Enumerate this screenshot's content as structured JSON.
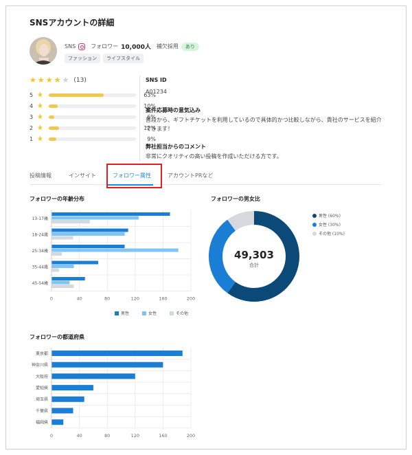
{
  "page": {
    "title": "SNSアカウントの詳細"
  },
  "profile": {
    "sns_label": "SNS",
    "follower_label": "フォロワー",
    "follower_count": "10,000人",
    "backup_label": "補欠採用",
    "backup_value": "あり",
    "tags": [
      "ファッション",
      "ライフスタイル"
    ]
  },
  "rating": {
    "stars": 4,
    "count_text": "(13)",
    "distribution": [
      {
        "star": "5",
        "pct_text": "63%",
        "pct": 63
      },
      {
        "star": "4",
        "pct_text": "10%",
        "pct": 10
      },
      {
        "star": "3",
        "pct_text": "6%",
        "pct": 6
      },
      {
        "star": "2",
        "pct_text": "12%",
        "pct": 12
      },
      {
        "star": "1",
        "pct_text": "9%",
        "pct": 9
      }
    ]
  },
  "details": {
    "sns_id_label": "SNS ID",
    "sns_id_value": "A01234",
    "motivation_label": "案件応募時の意気込み",
    "motivation_text": "普段から、ギフトチケットを利用しているので具体的かつ比較しながら、貴社のサービスを紹介できます！",
    "comment_label": "弊社担当からのコメント",
    "comment_text": "非常にクオリティの高い投稿を作成いただける方です。"
  },
  "tabs": [
    "投稿情報",
    "インサイト",
    "フォロワー属性",
    "アカウントPRなど"
  ],
  "colors": {
    "male": "#1a7fd4",
    "female": "#7fc4f5",
    "other": "#d5d8dc",
    "donut_male": "#0b4a78",
    "donut_female": "#1a7fd4",
    "donut_other": "#d5d8dc",
    "prefecture": "#1a7fd4"
  },
  "chart_data": [
    {
      "type": "bar",
      "title": "フォロワーの年齢分布",
      "categories": [
        "13-17歳",
        "18-24歳",
        "25-34歳",
        "35-44歳",
        "45-54歳"
      ],
      "series": [
        {
          "name": "男性",
          "values": [
            170,
            110,
            105,
            67,
            48
          ]
        },
        {
          "name": "女性",
          "values": [
            125,
            105,
            182,
            32,
            26
          ]
        },
        {
          "name": "その他",
          "values": [
            55,
            31,
            15,
            11,
            32
          ]
        }
      ],
      "xlim": [
        0,
        200
      ],
      "xticks": [
        "0",
        "40",
        "80",
        "120",
        "160",
        "200"
      ]
    },
    {
      "type": "pie",
      "title": "フォロワーの男女比",
      "center_value": "49,303",
      "center_label": "合計",
      "slices": [
        {
          "name": "男性 (60%)",
          "value": 60
        },
        {
          "name": "女性 (30%)",
          "value": 30
        },
        {
          "name": "その他 (10%)",
          "value": 10
        }
      ]
    },
    {
      "type": "bar",
      "title": "フォロワーの都道府県",
      "categories": [
        "東京都",
        "神奈川県",
        "大阪府",
        "愛知県",
        "埼玉県",
        "千葉県",
        "福岡県"
      ],
      "values": [
        188,
        160,
        120,
        60,
        47,
        31,
        17
      ],
      "xlim": [
        0,
        200
      ],
      "xticks": [
        "0",
        "40",
        "80",
        "120",
        "160",
        "200"
      ]
    }
  ]
}
